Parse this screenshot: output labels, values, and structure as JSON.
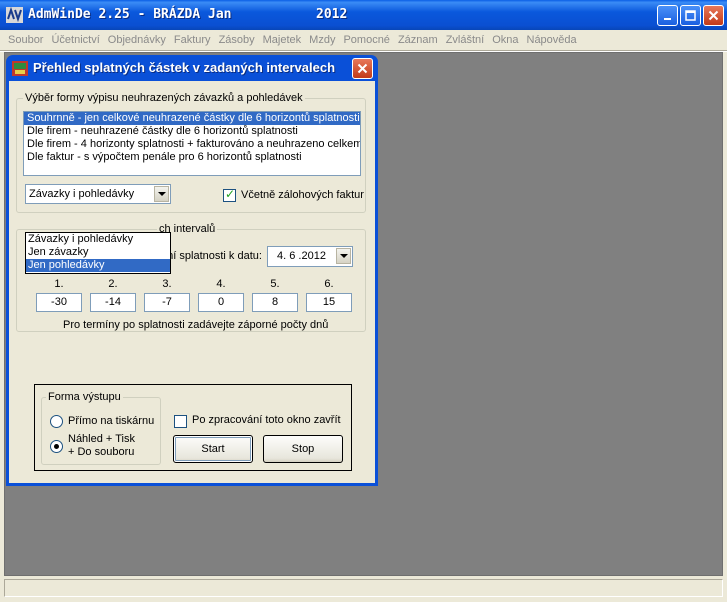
{
  "app": {
    "title": "AdmWinDe 2.25 - BRÁZDA Jan",
    "year": "2012"
  },
  "menu": [
    "Soubor",
    "Účetnictví",
    "Objednávky",
    "Faktury",
    "Zásoby",
    "Majetek",
    "Mzdy",
    "Pomocné",
    "Záznam",
    "Zvláštní",
    "Okna",
    "Nápověda"
  ],
  "dialog": {
    "title": "Přehled splatných částek v zadaných intervalech",
    "format_group_label": "Výběr formy výpisu neuhrazených závazků a pohledávek",
    "list_items": [
      "Souhrnně - jen celkové neuhrazené částky dle 6 horizontů splatnosti",
      "Dle firem - neuhrazené částky dle 6 horizontů splatnosti",
      "Dle firem - 4 horizonty splatnosti + fakturováno a neuhrazeno celkem",
      "Dle faktur - s výpočtem penále pro 6 horizontů splatnosti"
    ],
    "type_combo": {
      "value": "Závazky i pohledávky",
      "options": [
        "Závazky i pohledávky",
        "Jen závazky",
        "Jen pohledávky"
      ]
    },
    "include_advances_label": "Včetně zálohových faktur",
    "intervals_group_label": "ch intervalů",
    "due_date_label": "pro vyhodnocení splatnosti k datu:",
    "due_date_value": "4. 6 .2012",
    "interval_headers": [
      "1.",
      "2.",
      "3.",
      "4.",
      "5.",
      "6."
    ],
    "interval_values": [
      "-30",
      "-14",
      "-7",
      "0",
      "8",
      "15"
    ],
    "interval_hint": "Pro termíny po splatnosti zadávejte záporné počty dnů",
    "output_group_label": "Forma výstupu",
    "output_print_label": "Přímo na tiskárnu",
    "output_preview_line1": "Náhled + Tisk",
    "output_preview_line2": "+ Do souboru",
    "close_after_label": "Po zpracování toto okno zavřít",
    "start_label": "Start",
    "stop_label": "Stop"
  }
}
